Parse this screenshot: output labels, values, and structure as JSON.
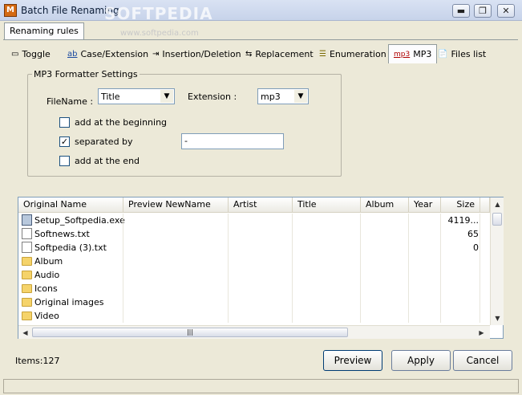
{
  "window": {
    "title": "Batch File Renaming",
    "watermark": "SOFTPEDIA",
    "watermark_url": "www.softpedia.com",
    "app_icon_text": "M"
  },
  "controls": {
    "minimize": "▬",
    "restore": "❐",
    "close": "✕"
  },
  "outer_tab": "Renaming rules",
  "tabs": [
    {
      "label": "Toggle",
      "icon": "▭"
    },
    {
      "label": "Case/Extension",
      "icon": "ab"
    },
    {
      "label": "Insertion/Deletion",
      "icon": "⇥"
    },
    {
      "label": "Replacement",
      "icon": "⇆"
    },
    {
      "label": "Enumeration",
      "icon": "☰"
    },
    {
      "label": "MP3",
      "icon": "mp3"
    },
    {
      "label": "Files list",
      "icon": "📄"
    }
  ],
  "mp3": {
    "group_label": "MP3 Formatter Settings",
    "filename_label": "FileName :",
    "filename_value": "Title",
    "extension_label": "Extension :",
    "extension_value": "mp3",
    "opt_begin": "add at the beginning",
    "opt_separated": "separated by",
    "separator_value": "-",
    "opt_end": "add at the end",
    "check_mark": "✓"
  },
  "columns": [
    "Original Name",
    "Preview NewName",
    "Artist",
    "Title",
    "Album",
    "Year",
    "Size"
  ],
  "rows": [
    {
      "name": "Setup_Softpedia.exe",
      "size": "4119...",
      "kind": "exe"
    },
    {
      "name": "Softnews.txt",
      "size": "65",
      "kind": "file"
    },
    {
      "name": "Softpedia (3).txt",
      "size": "0",
      "kind": "file"
    },
    {
      "name": "Album",
      "size": "",
      "kind": "folder"
    },
    {
      "name": "Audio",
      "size": "",
      "kind": "folder"
    },
    {
      "name": "Icons",
      "size": "",
      "kind": "folder"
    },
    {
      "name": "Original images",
      "size": "",
      "kind": "folder"
    },
    {
      "name": "Video",
      "size": "",
      "kind": "folder"
    }
  ],
  "scroll": {
    "up": "▲",
    "down": "▼",
    "left": "◀",
    "right": "▶",
    "grip": "|||"
  },
  "footer": {
    "items": "Items:127",
    "preview": "Preview",
    "apply": "Apply",
    "cancel": "Cancel"
  }
}
